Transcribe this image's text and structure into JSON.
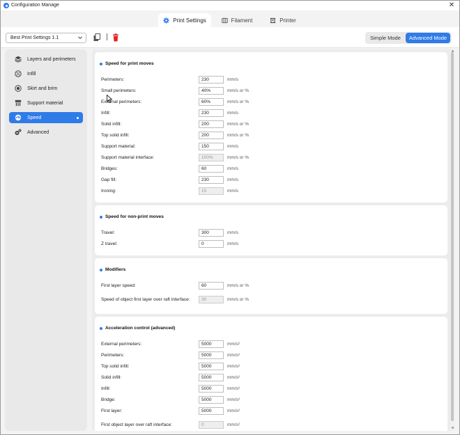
{
  "window": {
    "title": "Configuration Manage",
    "close_glyph": "✕"
  },
  "tabs": [
    {
      "label": "Print Settings",
      "icon": "gear-icon",
      "active": true
    },
    {
      "label": "Filament",
      "icon": "filament-spool-icon",
      "active": false
    },
    {
      "label": "Printer",
      "icon": "printer-icon",
      "active": false
    }
  ],
  "toolbar": {
    "preset": "Best Print Settings 1.1",
    "copy_icon": "copy-icon",
    "delete_icon": "delete-icon",
    "separator": "|",
    "modes": {
      "simple": "Simple Mode",
      "advanced": "Advanced Mode",
      "active": "advanced"
    }
  },
  "sidebar": {
    "items": [
      {
        "label": "Layers and perimeters",
        "icon": "layers-icon"
      },
      {
        "label": "Infill",
        "icon": "infill-icon"
      },
      {
        "label": "Skirt and brim",
        "icon": "skirt-icon"
      },
      {
        "label": "Support material",
        "icon": "support-icon"
      },
      {
        "label": "Speed",
        "icon": "speed-icon",
        "active": true
      },
      {
        "label": "Advanced",
        "icon": "advanced-icon"
      }
    ]
  },
  "sections": [
    {
      "title": "Speed for print moves",
      "rows": [
        {
          "label": "Perimeters:",
          "value": "230",
          "unit": "mm/s"
        },
        {
          "label": "Small perimeters:",
          "value": "40%",
          "unit": "mm/s or %"
        },
        {
          "label": "External perimeters:",
          "value": "60%",
          "unit": "mm/s or %"
        },
        {
          "label": "Infill:",
          "value": "230",
          "unit": "mm/s"
        },
        {
          "label": "Solid infill:",
          "value": "200",
          "unit": "mm/s or %"
        },
        {
          "label": "Top solid infill:",
          "value": "200",
          "unit": "mm/s or %"
        },
        {
          "label": "Support material:",
          "value": "150",
          "unit": "mm/s"
        },
        {
          "label": "Support material interface:",
          "value": "100%",
          "unit": "mm/s or %",
          "disabled": true
        },
        {
          "label": "Bridges:",
          "value": "60",
          "unit": "mm/s"
        },
        {
          "label": "Gap fill:",
          "value": "230",
          "unit": "mm/s"
        },
        {
          "label": "Ironing:",
          "value": "15",
          "unit": "mm/s",
          "disabled": true
        }
      ]
    },
    {
      "title": "Speed for non-print moves",
      "rows": [
        {
          "label": "Travel:",
          "value": "300",
          "unit": "mm/s"
        },
        {
          "label": "Z travel:",
          "value": "0",
          "unit": "mm/s"
        }
      ]
    },
    {
      "title": "Modifiers",
      "rows": [
        {
          "label": "First layer speed:",
          "value": "60",
          "unit": "mm/s or %"
        },
        {
          "label": "Speed of object first layer over raft interface:",
          "value": "30",
          "unit": "mm/s or %",
          "disabled": true
        }
      ]
    },
    {
      "title": "Acceleration control (advanced)",
      "rows": [
        {
          "label": "External perimeters:",
          "value": "5000",
          "unit": "mm/s²"
        },
        {
          "label": "Perimeters:",
          "value": "5000",
          "unit": "mm/s²"
        },
        {
          "label": "Top solid infill:",
          "value": "5000",
          "unit": "mm/s²"
        },
        {
          "label": "Solid infill:",
          "value": "5000",
          "unit": "mm/s²"
        },
        {
          "label": "Infill:",
          "value": "5000",
          "unit": "mm/s²"
        },
        {
          "label": "Bridge:",
          "value": "5000",
          "unit": "mm/s²"
        },
        {
          "label": "First layer:",
          "value": "5000",
          "unit": "mm/s²"
        },
        {
          "label": "First object layer over raft interface:",
          "value": "0",
          "unit": "mm/s²",
          "disabled": true
        }
      ]
    }
  ],
  "colors": {
    "accent": "#2f7be8",
    "delete": "#e02424"
  }
}
